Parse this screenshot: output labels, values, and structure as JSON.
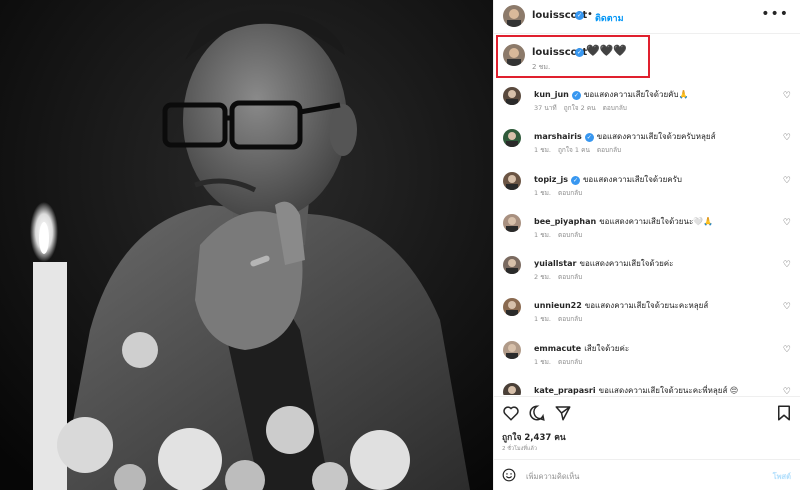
{
  "post": {
    "username": "louisscott",
    "follow_label": "ติดตาม",
    "more_label": "•••",
    "caption_emoji": "🖤🖤🖤",
    "caption_time": "2 ชม.",
    "likes": "ถูกใจ 2,437 คน",
    "posted_ago": "2 ชั่วโมงที่แล้ว",
    "comment_placeholder": "เพิ่มความคิดเห็น",
    "post_label": "โพสต์"
  },
  "comments": [
    {
      "user": "kun_jun",
      "verified": true,
      "text": "ขอแสดงความเสียใจด้วยคับ🙏",
      "time": "37 นาที",
      "likes": "ถูกใจ 2 คน",
      "reply": "ตอบกลับ"
    },
    {
      "user": "marshairis",
      "verified": true,
      "text": "ขอแสดงความเสียใจด้วยครับหลุยส์",
      "time": "1 ชม.",
      "likes": "ถูกใจ 1 คน",
      "reply": "ตอบกลับ"
    },
    {
      "user": "topiz_js",
      "verified": true,
      "text": "ขอแสดงความเสียใจด้วยครับ",
      "time": "1 ชม.",
      "likes": "",
      "reply": "ตอบกลับ"
    },
    {
      "user": "bee_piyaphan",
      "verified": false,
      "text": "ขอแสดงความเสียใจด้วยนะ🤍🙏",
      "time": "1 ชม.",
      "likes": "",
      "reply": "ตอบกลับ"
    },
    {
      "user": "yuiallstar",
      "verified": false,
      "text": "ขอแสดงความเสียใจด้วยค่ะ",
      "time": "2 ชม.",
      "likes": "",
      "reply": "ตอบกลับ"
    },
    {
      "user": "unnieun22",
      "verified": false,
      "text": "ขอแสดงความเสียใจด้วยนะคะหลุยส์",
      "time": "1 ชม.",
      "likes": "",
      "reply": "ตอบกลับ"
    },
    {
      "user": "emmacute",
      "verified": false,
      "text": "เสียใจด้วยค่ะ",
      "time": "1 ชม.",
      "likes": "",
      "reply": "ตอบกลับ"
    },
    {
      "user": "kate_prapasri",
      "verified": false,
      "text": "ขอแสดงความเสียใจด้วยนะคะพี่หลุยส์ 😔",
      "time": "",
      "likes": "",
      "reply": ""
    }
  ],
  "colors": {
    "accent": "#0095f6",
    "verified": "#3897f0",
    "highlight_box": "#e0202e",
    "muted_text": "#8e8e8e"
  },
  "icons": [
    "heart-icon",
    "comment-icon",
    "share-icon",
    "bookmark-icon",
    "emoji-icon",
    "verified-icon",
    "more-icon"
  ]
}
